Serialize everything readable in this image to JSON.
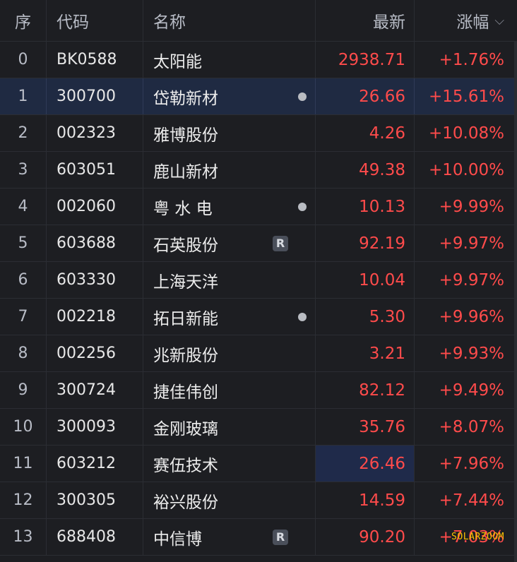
{
  "header": {
    "idx": "序",
    "code": "代码",
    "name": "名称",
    "price": "最新",
    "chg": "涨幅",
    "sort_icon": "chevron-down-icon"
  },
  "rows": [
    {
      "idx": "0",
      "code": "BK0588",
      "name": "太阳能",
      "price": "2938.71",
      "chg": "+1.76%",
      "tag": ""
    },
    {
      "idx": "1",
      "code": "300700",
      "name": "岱勒新材",
      "price": "26.66",
      "chg": "+15.61%",
      "tag": "dot"
    },
    {
      "idx": "2",
      "code": "002323",
      "name": "雅博股份",
      "price": "4.26",
      "chg": "+10.08%",
      "tag": ""
    },
    {
      "idx": "3",
      "code": "603051",
      "name": "鹿山新材",
      "price": "49.38",
      "chg": "+10.00%",
      "tag": ""
    },
    {
      "idx": "4",
      "code": "002060",
      "name": "粤 水 电",
      "price": "10.13",
      "chg": "+9.99%",
      "tag": "dot"
    },
    {
      "idx": "5",
      "code": "603688",
      "name": "石英股份",
      "price": "92.19",
      "chg": "+9.97%",
      "tag": "R"
    },
    {
      "idx": "6",
      "code": "603330",
      "name": "上海天洋",
      "price": "10.04",
      "chg": "+9.97%",
      "tag": ""
    },
    {
      "idx": "7",
      "code": "002218",
      "name": "拓日新能",
      "price": "5.30",
      "chg": "+9.96%",
      "tag": "dot"
    },
    {
      "idx": "8",
      "code": "002256",
      "name": "兆新股份",
      "price": "3.21",
      "chg": "+9.93%",
      "tag": ""
    },
    {
      "idx": "9",
      "code": "300724",
      "name": "捷佳伟创",
      "price": "82.12",
      "chg": "+9.49%",
      "tag": ""
    },
    {
      "idx": "10",
      "code": "300093",
      "name": "金刚玻璃",
      "price": "35.76",
      "chg": "+8.07%",
      "tag": ""
    },
    {
      "idx": "11",
      "code": "603212",
      "name": "赛伍技术",
      "price": "26.46",
      "chg": "+7.96%",
      "tag": ""
    },
    {
      "idx": "12",
      "code": "300305",
      "name": "裕兴股份",
      "price": "14.59",
      "chg": "+7.44%",
      "tag": ""
    },
    {
      "idx": "13",
      "code": "688408",
      "name": "中信博",
      "price": "90.20",
      "chg": "+7.03%",
      "tag": "R"
    }
  ],
  "selected_row": 1,
  "highlight_price_row": 11,
  "watermark": "SOLARZOOM",
  "colors": {
    "up": "#ff4b4b",
    "selected_bg": "#1f2a42",
    "background": "#1d1e22"
  }
}
